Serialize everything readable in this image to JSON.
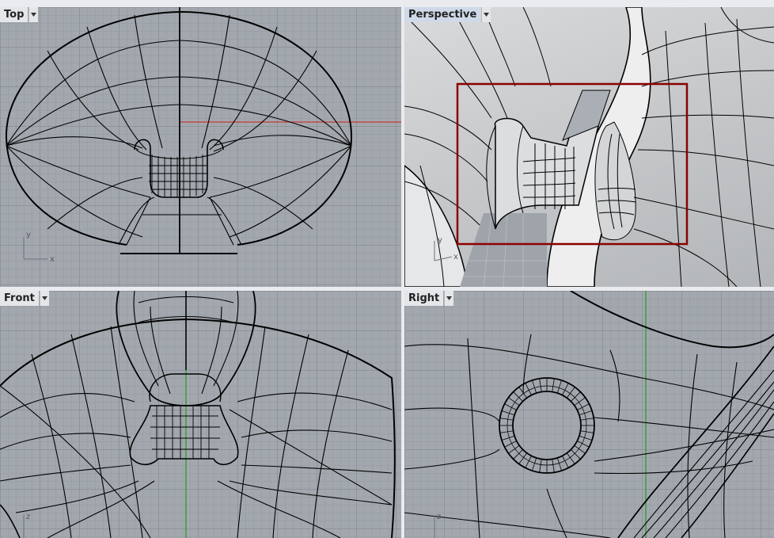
{
  "viewports": {
    "top": {
      "label": "Top",
      "axes": {
        "v": "y",
        "h": "x"
      }
    },
    "perspective": {
      "label": "Perspective",
      "axes": {
        "v": "y",
        "h": "x"
      }
    },
    "front": {
      "label": "Front",
      "axes": {
        "v": "z"
      }
    },
    "right": {
      "label": "Right",
      "axes": {
        "v": "z"
      }
    }
  },
  "colors": {
    "viewport_bg": "#a3a8ae",
    "grid_minor": "#9aa0a7",
    "grid_major": "#8e949b",
    "curve": "#000000",
    "x_axis": "#c43a3a",
    "z_axis": "#2f9e2f",
    "selection_box": "#8b0000",
    "active_label": "#cfd9e8"
  },
  "icons": {
    "viewport_menu": "triangle-down-icon"
  }
}
